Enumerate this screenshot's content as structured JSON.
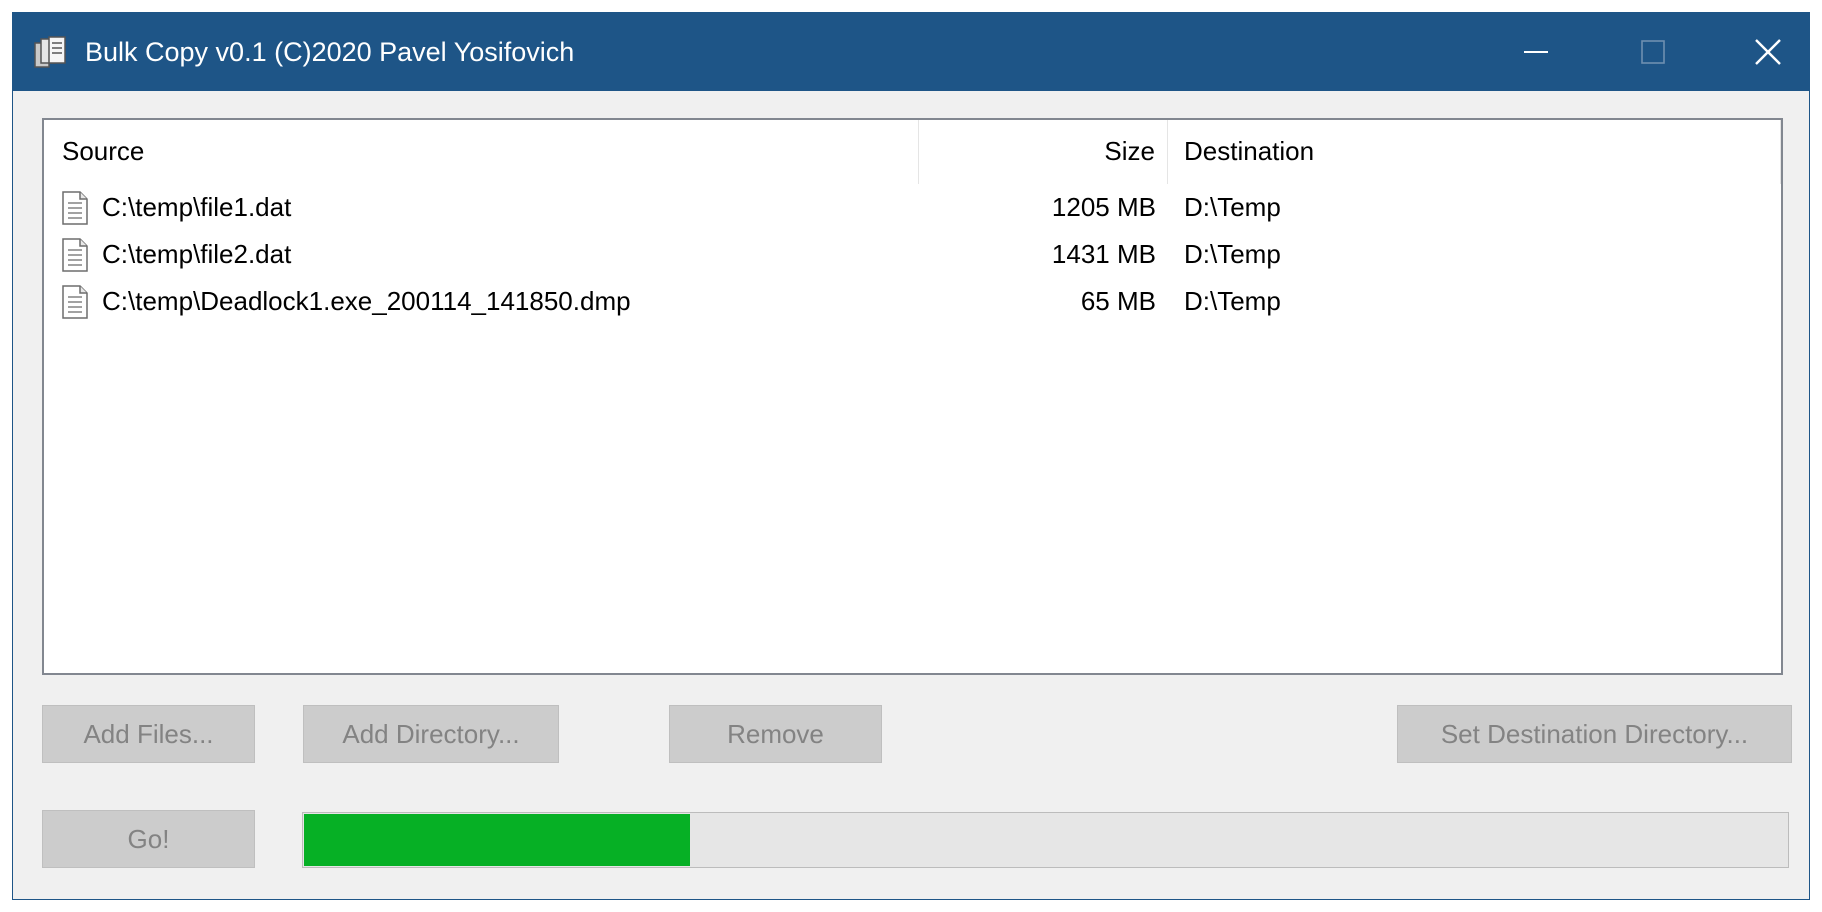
{
  "window": {
    "title": "Bulk Copy v0.1 (C)2020 Pavel Yosifovich",
    "app_icon": "copy-files-icon",
    "controls": [
      "minimize-icon",
      "maximize-icon",
      "close-icon"
    ],
    "titlebar_color": "#1e5587"
  },
  "list": {
    "columns": {
      "source": "Source",
      "size": "Size",
      "destination": "Destination"
    },
    "rows": [
      {
        "source": "C:\\temp\\file1.dat",
        "size": "1205 MB",
        "destination": "D:\\Temp",
        "icon": "document-icon"
      },
      {
        "source": "C:\\temp\\file2.dat",
        "size": "1431 MB",
        "destination": "D:\\Temp",
        "icon": "document-icon"
      },
      {
        "source": "C:\\temp\\Deadlock1.exe_200114_141850.dmp",
        "size": "65 MB",
        "destination": "D:\\Temp",
        "icon": "document-icon"
      }
    ]
  },
  "buttons": {
    "add_files": "Add Files...",
    "add_directory": "Add Directory...",
    "remove": "Remove",
    "set_destination": "Set Destination Directory...",
    "go": "Go!"
  },
  "progress": {
    "fraction": 0.26,
    "color": "#06b025"
  }
}
